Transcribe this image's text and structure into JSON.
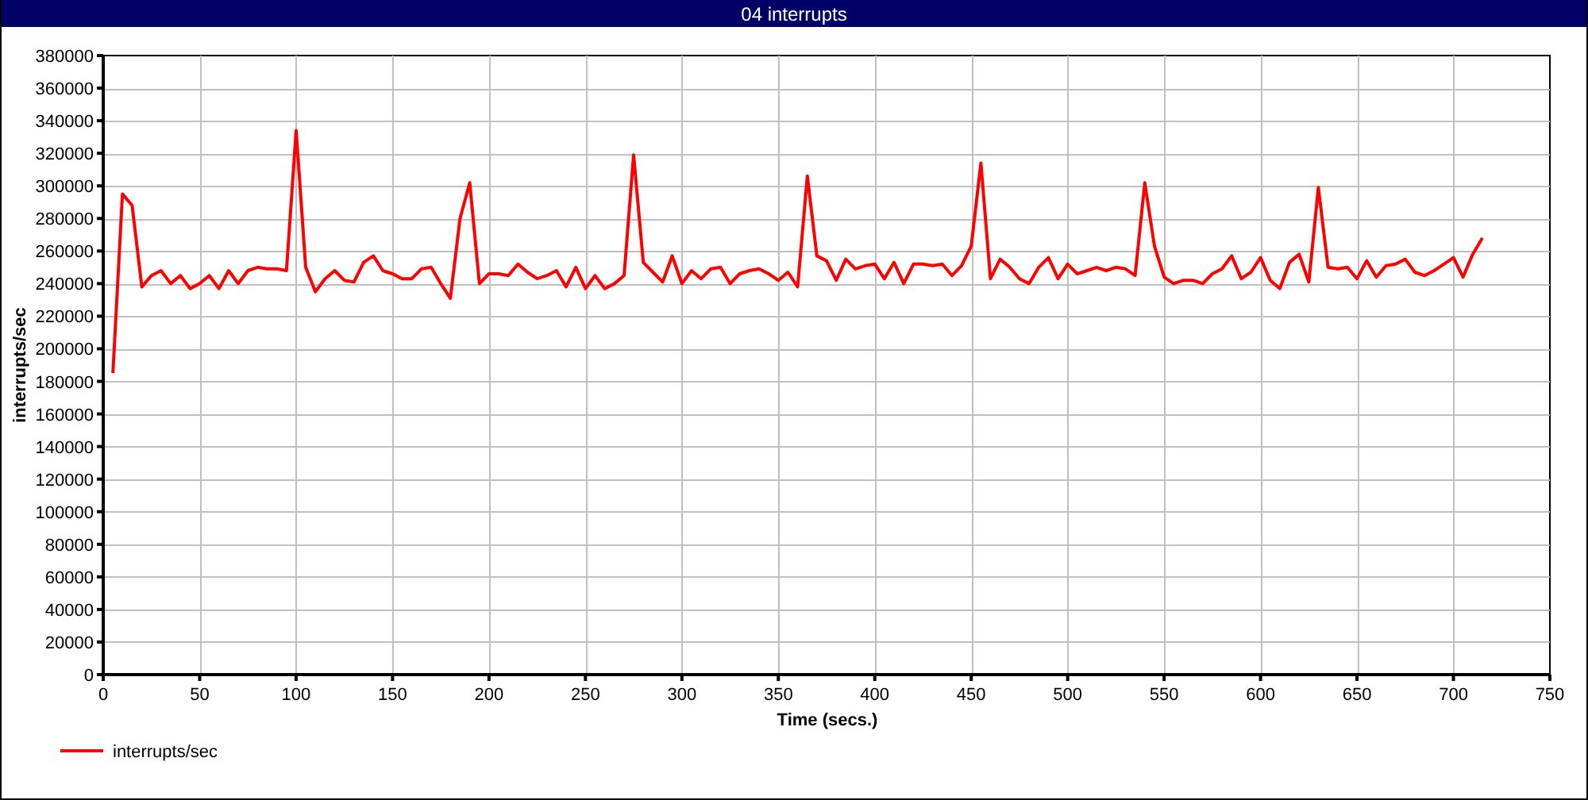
{
  "window": {
    "title": "04 interrupts"
  },
  "chart_data": {
    "type": "line",
    "xlabel": "Time (secs.)",
    "ylabel": "interrupts/sec",
    "x": [
      5,
      10,
      15,
      20,
      25,
      30,
      35,
      40,
      45,
      50,
      55,
      60,
      65,
      70,
      75,
      80,
      85,
      90,
      95,
      100,
      105,
      110,
      115,
      120,
      125,
      130,
      135,
      140,
      145,
      150,
      155,
      160,
      165,
      170,
      175,
      180,
      185,
      190,
      195,
      200,
      205,
      210,
      215,
      220,
      225,
      230,
      235,
      240,
      245,
      250,
      255,
      260,
      265,
      270,
      275,
      280,
      285,
      290,
      295,
      300,
      305,
      310,
      315,
      320,
      325,
      330,
      335,
      340,
      345,
      350,
      355,
      360,
      365,
      370,
      375,
      380,
      385,
      390,
      395,
      400,
      405,
      410,
      415,
      420,
      425,
      430,
      435,
      440,
      445,
      450,
      455,
      460,
      465,
      470,
      475,
      480,
      485,
      490,
      495,
      500,
      505,
      510,
      515,
      520,
      525,
      530,
      535,
      540,
      545,
      550,
      555,
      560,
      565,
      570,
      575,
      580,
      585,
      590,
      595,
      600,
      605,
      610,
      615,
      620,
      625,
      630,
      635,
      640,
      645,
      650,
      655,
      660,
      665,
      670,
      675,
      680,
      685,
      690,
      695,
      700,
      705,
      710,
      715
    ],
    "series": [
      {
        "name": "interrupts/sec",
        "color": "#ff0000",
        "values": [
          185000,
          295000,
          288000,
          238000,
          245000,
          248000,
          240000,
          245000,
          237000,
          240000,
          245000,
          237000,
          248000,
          240000,
          248000,
          250000,
          249000,
          249000,
          248000,
          334000,
          250000,
          235000,
          243000,
          248000,
          242000,
          241000,
          253000,
          257000,
          248000,
          246000,
          243000,
          243000,
          249000,
          250000,
          240000,
          231000,
          280000,
          302000,
          240000,
          246000,
          246000,
          245000,
          252000,
          247000,
          243000,
          245000,
          248000,
          238000,
          250000,
          237000,
          245000,
          237000,
          240000,
          245000,
          319000,
          253000,
          247000,
          241000,
          257000,
          240000,
          248000,
          243000,
          249000,
          250000,
          240000,
          246000,
          248000,
          249000,
          246000,
          242000,
          247000,
          238000,
          306000,
          257000,
          254000,
          242000,
          255000,
          249000,
          251000,
          252000,
          243000,
          253000,
          240000,
          252000,
          252000,
          251000,
          252000,
          245000,
          251000,
          263000,
          314000,
          243000,
          255000,
          250000,
          243000,
          240000,
          250000,
          256000,
          243000,
          252000,
          246000,
          248000,
          250000,
          248000,
          250000,
          249000,
          245000,
          302000,
          263000,
          244000,
          240000,
          242000,
          242000,
          240000,
          246000,
          249000,
          257000,
          243000,
          247000,
          256000,
          242000,
          237000,
          253000,
          258000,
          241000,
          299000,
          250000,
          249000,
          250000,
          243000,
          254000,
          244000,
          251000,
          252000,
          255000,
          247000,
          245000,
          248000,
          252000,
          256000,
          244000,
          258000,
          268000
        ]
      }
    ],
    "grid": true,
    "xlim": [
      0,
      750
    ],
    "ylim": [
      0,
      380000
    ],
    "xticks": [
      0,
      50,
      100,
      150,
      200,
      250,
      300,
      350,
      400,
      450,
      500,
      550,
      600,
      650,
      700,
      750
    ],
    "yticks": [
      0,
      20000,
      40000,
      60000,
      80000,
      100000,
      120000,
      140000,
      160000,
      180000,
      200000,
      220000,
      240000,
      260000,
      280000,
      300000,
      320000,
      340000,
      360000,
      380000
    ]
  }
}
